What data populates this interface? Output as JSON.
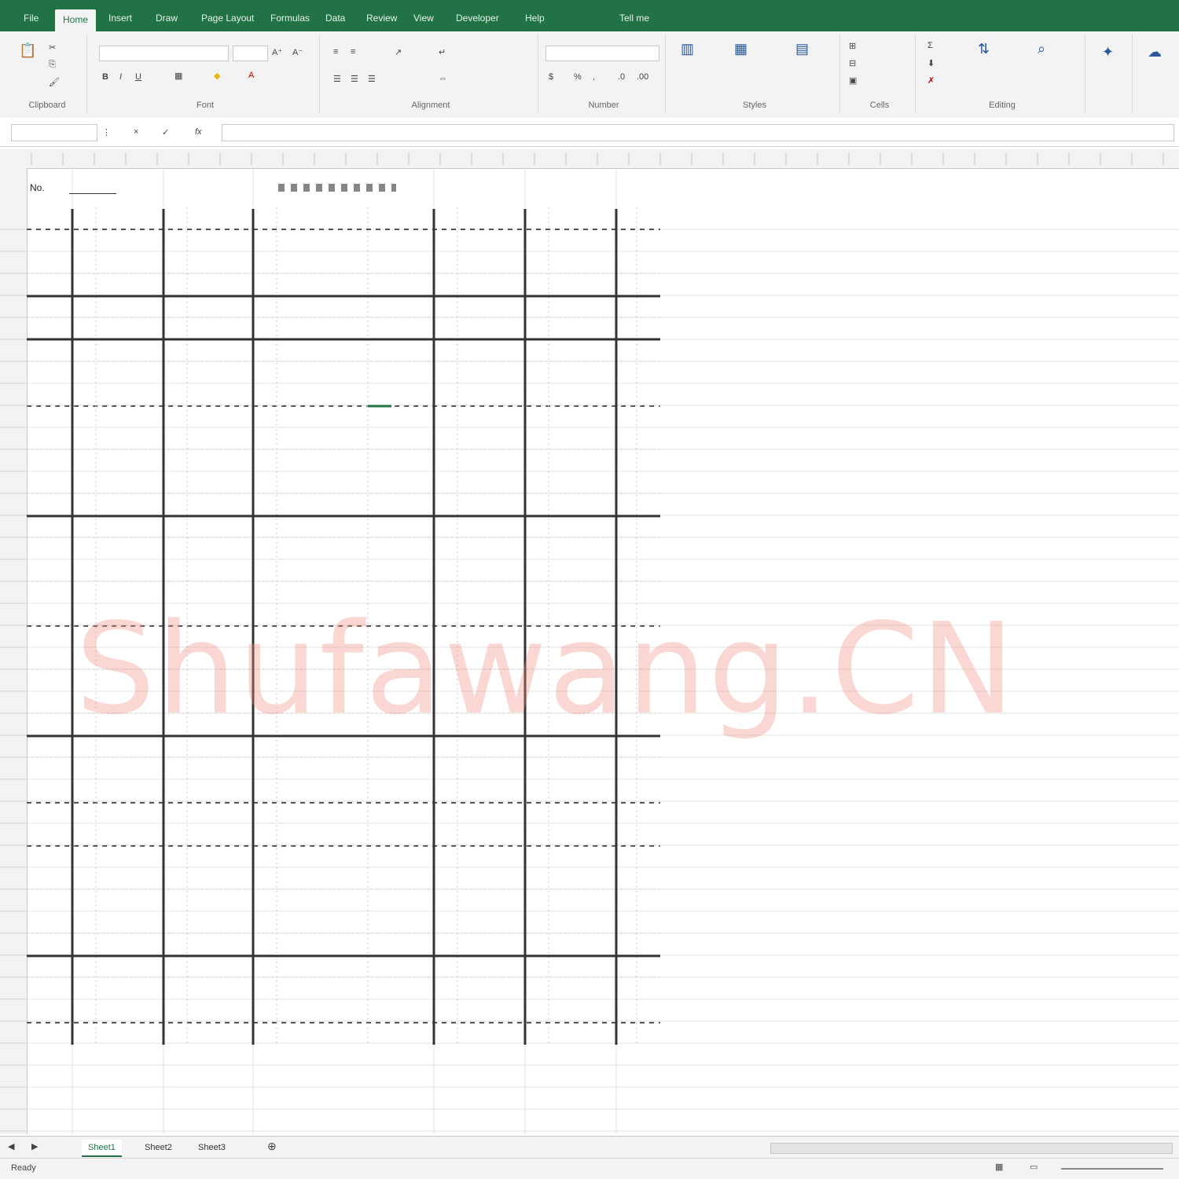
{
  "tabs": {
    "items": [
      "File",
      "Home",
      "Insert",
      "Draw",
      "Page Layout",
      "Formulas",
      "Data",
      "Review",
      "View",
      "Developer",
      "Help",
      "Tell me"
    ],
    "active_index": 1
  },
  "ribbon": {
    "groups": [
      "Clipboard",
      "Font",
      "Alignment",
      "Number",
      "Styles",
      "Cells",
      "Editing"
    ]
  },
  "formula_bar": {
    "name_box": "",
    "fx": "fx"
  },
  "sheet": {
    "header_left": "No.",
    "header_right": ""
  },
  "watermark": "Shufawang.CN",
  "sheet_tabs": [
    "Sheet1",
    "Sheet2",
    "Sheet3"
  ],
  "status": {
    "left": "Ready"
  },
  "colors": {
    "brand": "#217346",
    "grid": "#cccccc",
    "border": "#333333"
  }
}
